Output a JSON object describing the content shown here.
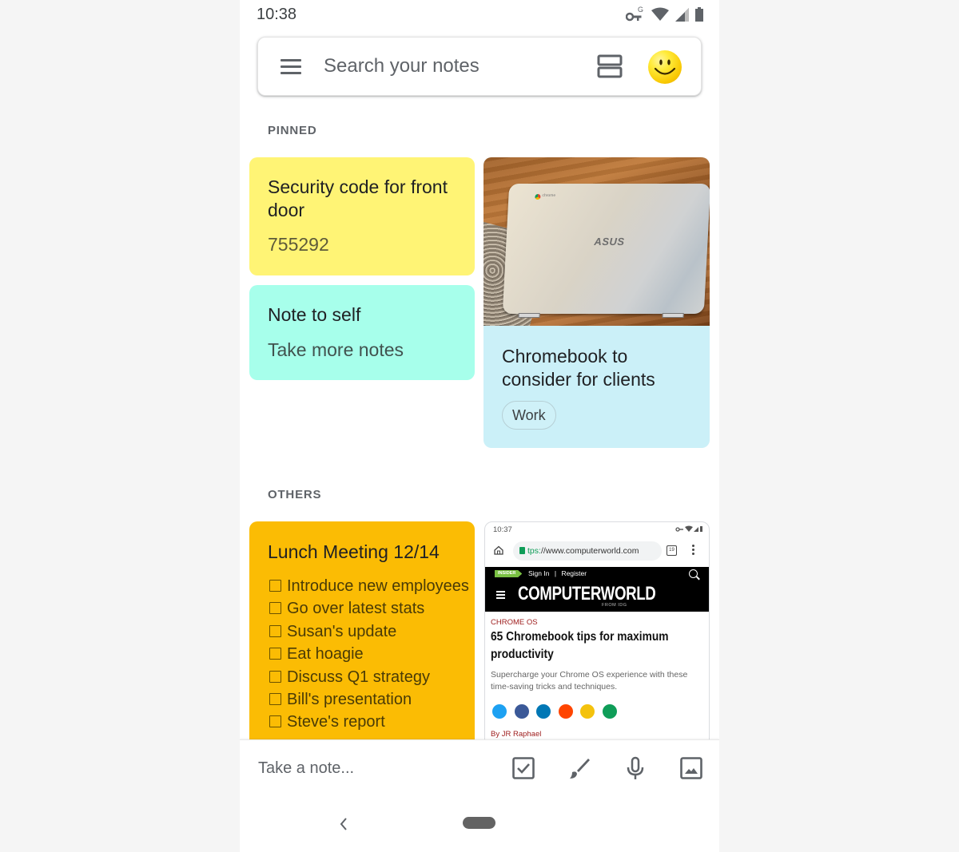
{
  "status_bar": {
    "time": "10:38",
    "icons": [
      "vpn-key-icon",
      "wifi-icon",
      "signal-icon",
      "battery-icon"
    ],
    "vpn_badge": "G"
  },
  "search_bar": {
    "placeholder": "Search your notes",
    "menu_icon": "hamburger-menu-icon",
    "layout_icon": "view-agenda-icon",
    "avatar": "smiley-face-avatar"
  },
  "sections": {
    "pinned_label": "PINNED",
    "others_label": "OTHERS"
  },
  "pinned_notes": [
    {
      "title": "Security code for front door",
      "body": "755292",
      "color": "#fff475"
    },
    {
      "title": "Note to self",
      "body": "Take more notes",
      "color": "#a7ffeb"
    },
    {
      "title": "Chromebook to consider for clients",
      "image": "ASUS Chromebook laptop on wooden floor",
      "image_brand_text": "ASUS",
      "image_chrome_text": "chrome",
      "label": "Work",
      "color": "#cbf0f8"
    }
  ],
  "other_notes": [
    {
      "title": "Lunch Meeting 12/14",
      "color": "#fbbc04",
      "checklist": [
        {
          "text": "Introduce new employees",
          "checked": false
        },
        {
          "text": "Go over latest stats",
          "checked": false
        },
        {
          "text": "Susan's update",
          "checked": false
        },
        {
          "text": "Eat hoagie",
          "checked": false
        },
        {
          "text": "Discuss Q1 strategy",
          "checked": false
        },
        {
          "text": "Bill's presentation",
          "checked": false
        },
        {
          "text": "Steve's report",
          "checked": false
        }
      ]
    },
    {
      "type": "screenshot",
      "screenshot": {
        "time": "10:37",
        "url_scheme": "tps:",
        "url_rest": "//www.computerworld.com",
        "tab_count": "19",
        "insider_badge": "INSIDER",
        "sign_in": "Sign In",
        "separator": "|",
        "register": "Register",
        "brand": "COMPUTERWORLD",
        "brand_sub": "FROM IDG",
        "category": "CHROME OS",
        "headline": "65 Chromebook tips for maximum productivity",
        "dek": "Supercharge your Chrome OS experience with these time-saving tricks and techniques.",
        "share_icons": [
          {
            "name": "twitter-icon",
            "color": "#1da1f2"
          },
          {
            "name": "facebook-icon",
            "color": "#3b5998"
          },
          {
            "name": "linkedin-icon",
            "color": "#0077b5"
          },
          {
            "name": "reddit-icon",
            "color": "#ff4500"
          },
          {
            "name": "email-icon",
            "color": "#f4c20d"
          },
          {
            "name": "print-icon",
            "color": "#0f9d58"
          }
        ],
        "byline": "By JR Raphael"
      }
    }
  ],
  "bottom_bar": {
    "placeholder": "Take a note...",
    "actions": [
      "new-list-icon",
      "drawing-icon",
      "voice-note-icon",
      "image-note-icon"
    ]
  },
  "nav_bar": {
    "back": "back-icon",
    "home": "home-pill"
  }
}
